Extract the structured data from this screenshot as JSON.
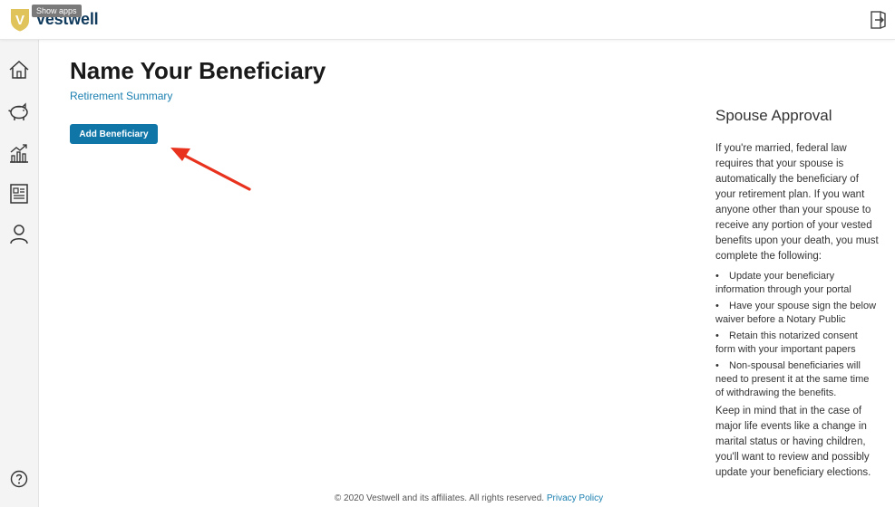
{
  "header": {
    "brand": "Vestwell",
    "logo_letter": "V",
    "tooltip": "Show apps"
  },
  "sidebar": {
    "items": [
      {
        "icon": "home-icon"
      },
      {
        "icon": "piggy-bank-icon"
      },
      {
        "icon": "chart-icon"
      },
      {
        "icon": "documents-icon"
      },
      {
        "icon": "user-icon"
      }
    ],
    "help_icon": "help-icon"
  },
  "main": {
    "title": "Name Your Beneficiary",
    "breadcrumb_link": "Retirement Summary",
    "add_button": "Add Beneficiary"
  },
  "aside": {
    "title": "Spouse Approval",
    "intro": "If you're married, federal law requires that your spouse is automatically the beneficiary of your retirement plan. If you want anyone other than your spouse to receive any portion of your vested benefits upon your death, you must complete the following:",
    "bullet_char": "•",
    "bullets": [
      "Update your beneficiary information through your portal",
      "Have your spouse sign the below waiver before a Notary Public",
      "Retain this notarized consent form with your important papers",
      "Non-spousal beneficiaries will need to present it at the same time of withdrawing the benefits."
    ],
    "closing": "Keep in mind that in the case of major life events like a change in marital status or having children, you'll want to review and possibly update your beneficiary elections."
  },
  "footer": {
    "copyright": "© 2020 Vestwell and its affiliates. All rights reserved.",
    "privacy_link": "Privacy Policy"
  },
  "colors": {
    "brand_navy": "#103a5c",
    "brand_gold": "#e0c35a",
    "primary_button": "#1076a8",
    "link": "#1a7fb0",
    "annotation_arrow": "#e8321e"
  }
}
